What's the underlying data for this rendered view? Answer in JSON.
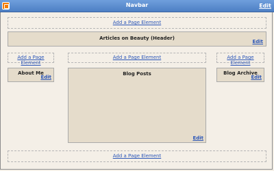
{
  "navbar": {
    "title": "Navbar",
    "edit": "Edit",
    "logo_icon": "blogger-icon"
  },
  "add_page_element": "Add a Page Element",
  "header_panel": {
    "title": "Articles on Beauty (Header)",
    "edit": "Edit"
  },
  "sidebar_left": {
    "title": "About Me",
    "edit": "Edit"
  },
  "main": {
    "title": "Blog Posts",
    "edit": "Edit"
  },
  "sidebar_right": {
    "title": "Blog Archive",
    "edit": "Edit"
  },
  "colors": {
    "navbar": "#5b8bd0",
    "panel": "#e5dccb",
    "background": "#f4efe7",
    "link": "#2b56b8"
  }
}
